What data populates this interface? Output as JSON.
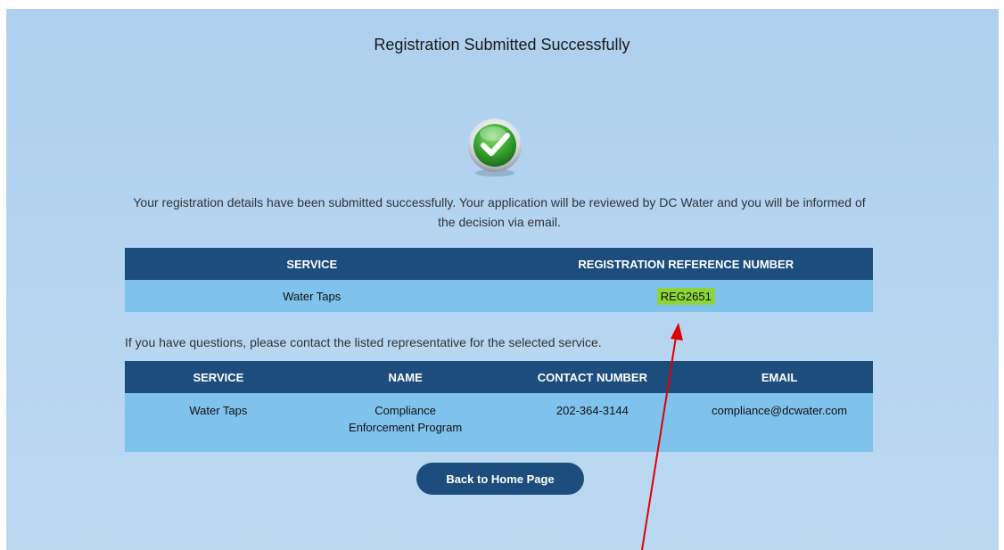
{
  "page": {
    "title": "Registration Submitted Successfully",
    "message": "Your registration details have been submitted successfully. Your application will be reviewed by DC Water and you will be informed of the decision via email.",
    "status_icon": "check-icon",
    "colors": {
      "header_bg": "#1d4d7c",
      "row_bg": "#7fc2ec",
      "highlight": "#8cd63a",
      "arrow": "#e00000",
      "check_green": "#3aa832"
    }
  },
  "registration_table": {
    "headers": [
      "SERVICE",
      "REGISTRATION REFERENCE NUMBER"
    ],
    "rows": [
      {
        "service": "Water Taps",
        "reference": "REG2651"
      }
    ]
  },
  "contact_note": "If you have questions, please contact the listed representative for the selected service.",
  "contact_table": {
    "headers": [
      "SERVICE",
      "NAME",
      "CONTACT NUMBER",
      "EMAIL"
    ],
    "rows": [
      {
        "service": "Water Taps",
        "name": "Compliance Enforcement Program",
        "phone": "202-364-3144",
        "email": "compliance@dcwater.com"
      }
    ]
  },
  "actions": {
    "home_label": "Back to Home Page"
  }
}
